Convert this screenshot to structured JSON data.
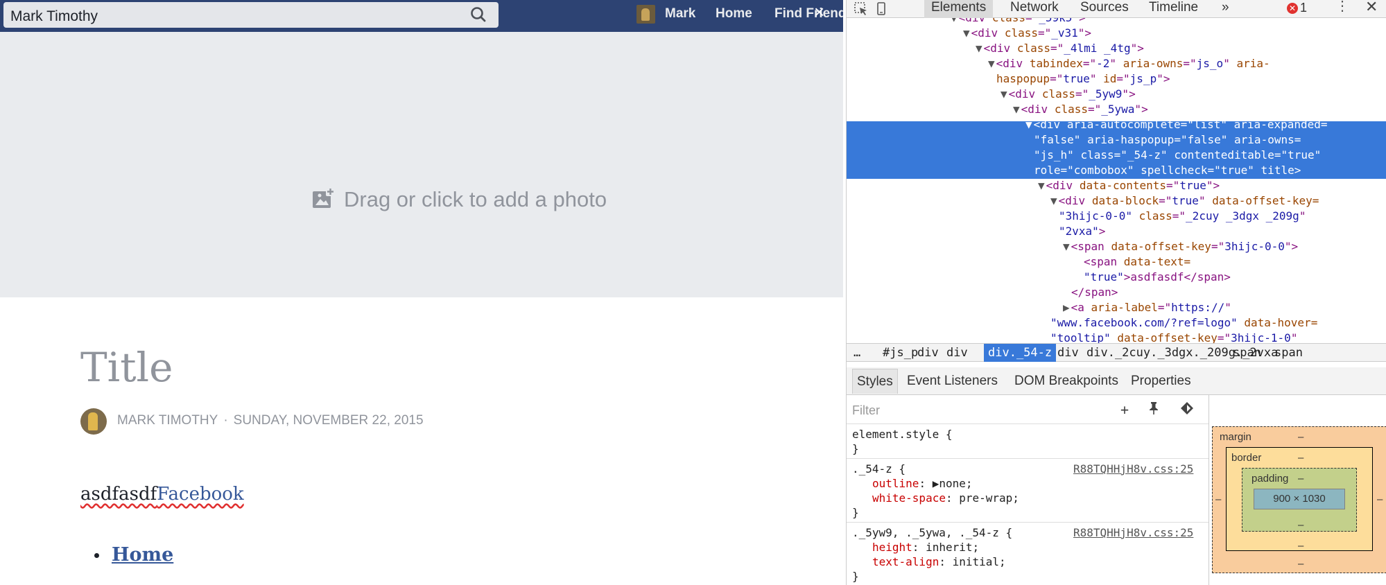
{
  "facebook": {
    "search_value": "Mark Timothy",
    "nav": {
      "profile_name": "Mark",
      "home": "Home",
      "find_friends": "Find Friends"
    },
    "close_glyph": "×",
    "cover_hint": "Drag or click to add a photo",
    "post": {
      "title": "Title",
      "author": "MARK TIMOTHY",
      "separator": "·",
      "date": "SUNDAY, NOVEMBER 22, 2015",
      "body_text": "asdfasdf",
      "body_link": "Facebook",
      "list_items": [
        "Home"
      ]
    },
    "colors": {
      "bar": "#2d4373",
      "link": "#365899",
      "muted": "#90949c"
    }
  },
  "devtools": {
    "tabs": [
      "Elements",
      "Network",
      "Sources",
      "Timeline"
    ],
    "more_tabs": "»",
    "error_count": "1",
    "dom_lines": [
      {
        "open": "<div ",
        "attrs": [
          [
            "class",
            "_59k5"
          ]
        ],
        "close": ">"
      },
      {
        "open": "<div ",
        "attrs": [
          [
            "class",
            "_v31"
          ]
        ],
        "close": ">"
      },
      {
        "open": "<div ",
        "attrs": [
          [
            "class",
            "_4lmi _4tg"
          ]
        ],
        "close": ">"
      },
      {
        "open": "<div ",
        "attrs": [
          [
            "tabindex",
            "-2"
          ],
          [
            "aria-owns",
            "js_o"
          ],
          [
            "aria-"
          ]
        ],
        "close": ""
      },
      {
        "open": "",
        "attrs": [
          [
            "haspopup",
            "true"
          ],
          [
            "id",
            "js_p"
          ]
        ],
        "close": ">"
      },
      {
        "open": "<div ",
        "attrs": [
          [
            "class",
            "_5yw9"
          ]
        ],
        "close": ">"
      },
      {
        "open": "<div ",
        "attrs": [
          [
            "class",
            "_5ywa"
          ]
        ],
        "close": ">"
      },
      {
        "open": "<div ",
        "attrs": [
          [
            "aria-autocomplete",
            "list"
          ],
          [
            "aria-expanded="
          ]
        ],
        "close": ""
      },
      {
        "open": "",
        "attrs": [
          [
            "false",
            ""
          ],
          [
            "aria-haspopup",
            "false"
          ],
          [
            "aria-owns="
          ]
        ],
        "close": ""
      },
      {
        "open": "",
        "attrs": [
          [
            "js_h",
            ""
          ],
          [
            "class",
            "_54-z"
          ],
          [
            "contenteditable",
            "true"
          ]
        ],
        "close": ""
      },
      {
        "open": "",
        "attrs": [
          [
            "role",
            "combobox"
          ],
          [
            "spellcheck",
            "true"
          ],
          [
            "title"
          ]
        ],
        "close": ">"
      },
      {
        "open": "<div ",
        "attrs": [
          [
            "data-contents",
            "true"
          ]
        ],
        "close": ">"
      },
      {
        "open": "<div ",
        "attrs": [
          [
            "data-block",
            "true"
          ],
          [
            "data-offset-key="
          ]
        ],
        "close": ""
      },
      {
        "open": "",
        "attrs": [
          [
            "3hijc-0-0",
            ""
          ],
          [
            "class",
            "_2cuy _3dgx _209g"
          ]
        ],
        "close": ""
      },
      {
        "open": "",
        "attrs": [
          [
            "2vxa",
            ""
          ]
        ],
        "close": ">"
      },
      {
        "open": "<span ",
        "attrs": [
          [
            "data-offset-key",
            "3hijc-0-0"
          ]
        ],
        "close": ">"
      },
      {
        "open": "<span ",
        "attrs": [
          [
            "data-text="
          ]
        ],
        "close": ""
      },
      {
        "open": "",
        "attrs": [
          [
            "true",
            ""
          ]
        ],
        "close": ">asdfasdf</span>"
      },
      {
        "open": "</span>",
        "attrs": [],
        "close": ""
      },
      {
        "open": "<a ",
        "attrs": [
          [
            "aria-label",
            "https://"
          ]
        ],
        "close": ""
      },
      {
        "open": "",
        "attrs": [
          [
            "www.facebook.com/?ref=logo",
            ""
          ],
          [
            "data-hover="
          ]
        ],
        "close": ""
      },
      {
        "open": "",
        "attrs": [
          [
            "tooltip",
            ""
          ],
          [
            "data-offset-key",
            "3hijc-1-0"
          ]
        ],
        "close": ""
      }
    ],
    "breadcrumbs": [
      "…",
      "#js_p",
      "div",
      "div",
      "div._54-z",
      "div",
      "div._2cuy._3dgx._209g._2vxa",
      "span",
      "span"
    ],
    "subtabs": [
      "Styles",
      "Event Listeners",
      "DOM Breakpoints",
      "Properties"
    ],
    "filter_placeholder": "Filter",
    "styles": [
      {
        "selector": "element.style {",
        "props": [],
        "source": ""
      },
      {
        "selector": "._54-z {",
        "props": [
          [
            "outline",
            "▶none;"
          ],
          [
            "white-space",
            "pre-wrap;"
          ]
        ],
        "source": "R88TQHHjH8v.css:25"
      },
      {
        "selector": "._5yw9, ._5ywa, ._54-z {",
        "props": [
          [
            "height",
            "inherit;"
          ],
          [
            "text-align",
            "initial;"
          ]
        ],
        "source": "R88TQHHjH8v.css:25"
      }
    ],
    "box_model": {
      "margin_label": "margin",
      "border_label": "border",
      "padding_label": "padding",
      "dash": "–",
      "content_size": "900 × 1030"
    },
    "colors": {
      "selection": "#3879d9",
      "tag": "#881280",
      "attr_name": "#994500",
      "attr_value": "#1a1aa6"
    }
  }
}
